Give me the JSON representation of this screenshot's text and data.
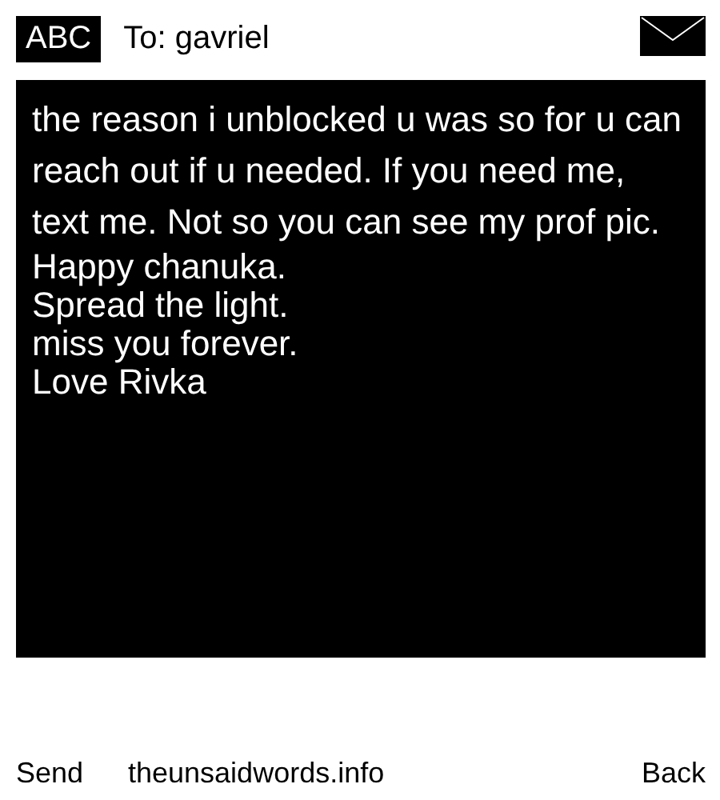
{
  "header": {
    "mode": "ABC",
    "recipient": "To: gavriel"
  },
  "message": {
    "paragraphs": [
      "the reason i unblocked u was so for u can reach out if u needed. If you need me, text me. Not so you can see my prof pic.",
      "Happy chanuka.",
      "Spread the light.",
      "miss you forever.",
      "Love Rivka"
    ]
  },
  "footer": {
    "left": "Send",
    "center": "theunsaidwords.info",
    "right": "Back"
  }
}
